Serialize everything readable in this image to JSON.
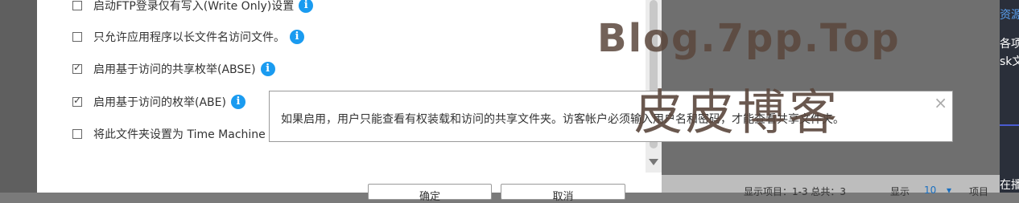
{
  "options": [
    {
      "label": "启动FTP登录仅有写入(Write Only)设置",
      "checked": false,
      "info": true
    },
    {
      "label": "只允许应用程序以长文件名访问文件。",
      "checked": false,
      "info": true
    },
    {
      "label": "启用基于访问的共享枚举(ABSE)",
      "checked": true,
      "info": true
    },
    {
      "label": "启用基于访问的枚举(ABE)",
      "checked": true,
      "info": true
    },
    {
      "label": "将此文件夹设置为 Time Machine",
      "checked": false,
      "info": false
    }
  ],
  "tooltip": {
    "text": "如果启用，用户只能查看有权装载和访问的共享文件夹。访客帐户必须输入用户名和密码，才能查看共享文件夹。",
    "close": "×"
  },
  "buttons": {
    "ok": "确定",
    "cancel": "取消"
  },
  "footer": {
    "items": "显示项目：1-3 总共：3",
    "show": "显示",
    "count": "10",
    "unit": "项目"
  },
  "side": {
    "t1": "资源",
    "t2": "各项",
    "t3": "sk文",
    "t4": "在播"
  },
  "watermark": {
    "line1": "Blog.7pp.Top",
    "line2": "皮皮博客"
  },
  "icons": {
    "info": "info-icon",
    "close": "close-icon",
    "scroll": "chevron-down-icon"
  }
}
